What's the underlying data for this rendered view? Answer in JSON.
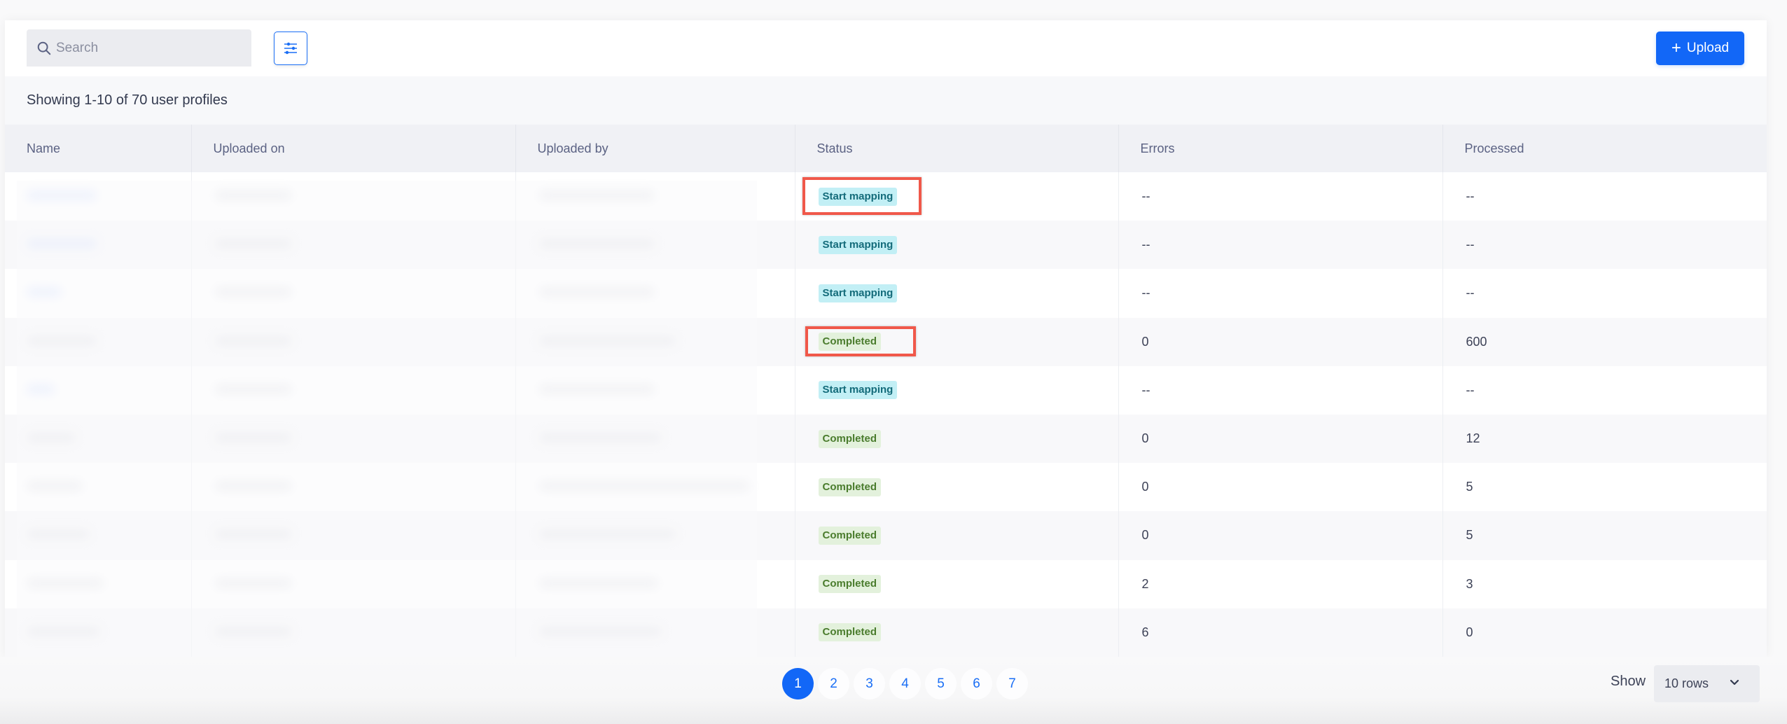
{
  "toolbar": {
    "search_placeholder": "Search",
    "search_value": "",
    "filter_icon": "sliders-icon",
    "upload_label": "Upload",
    "upload_icon": "plus-icon"
  },
  "summary": "Showing 1-10 of 70 user profiles",
  "table": {
    "columns": [
      "Name",
      "Uploaded on",
      "Uploaded by",
      "Status",
      "Errors",
      "Processed"
    ],
    "rows": [
      {
        "name": "",
        "uploaded_on": "",
        "uploaded_by": "",
        "status": "Start mapping",
        "status_type": "mapping",
        "errors": "--",
        "processed": "--",
        "highlighted": true
      },
      {
        "name": "",
        "uploaded_on": "",
        "uploaded_by": "",
        "status": "Start mapping",
        "status_type": "mapping",
        "errors": "--",
        "processed": "--",
        "highlighted": false
      },
      {
        "name": "",
        "uploaded_on": "",
        "uploaded_by": "",
        "status": "Start mapping",
        "status_type": "mapping",
        "errors": "--",
        "processed": "--",
        "highlighted": false
      },
      {
        "name": "",
        "uploaded_on": "",
        "uploaded_by": "",
        "status": "Completed",
        "status_type": "completed",
        "errors": "0",
        "processed": "600",
        "highlighted": true
      },
      {
        "name": "",
        "uploaded_on": "",
        "uploaded_by": "",
        "status": "Start mapping",
        "status_type": "mapping",
        "errors": "--",
        "processed": "--",
        "highlighted": false
      },
      {
        "name": "",
        "uploaded_on": "",
        "uploaded_by": "",
        "status": "Completed",
        "status_type": "completed",
        "errors": "0",
        "processed": "12",
        "highlighted": false
      },
      {
        "name": "",
        "uploaded_on": "",
        "uploaded_by": "",
        "status": "Completed",
        "status_type": "completed",
        "errors": "0",
        "processed": "5",
        "highlighted": false
      },
      {
        "name": "",
        "uploaded_on": "",
        "uploaded_by": "",
        "status": "Completed",
        "status_type": "completed",
        "errors": "0",
        "processed": "5",
        "highlighted": false
      },
      {
        "name": "",
        "uploaded_on": "",
        "uploaded_by": "",
        "status": "Completed",
        "status_type": "completed",
        "errors": "2",
        "processed": "3",
        "highlighted": false
      },
      {
        "name": "",
        "uploaded_on": "",
        "uploaded_by": "",
        "status": "Completed",
        "status_type": "completed",
        "errors": "6",
        "processed": "0",
        "highlighted": false
      }
    ],
    "redacted_columns": [
      "Name",
      "Uploaded on",
      "Uploaded by"
    ]
  },
  "pagination": {
    "pages": [
      "1",
      "2",
      "3",
      "4",
      "5",
      "6",
      "7"
    ],
    "current": "1"
  },
  "rows_per_page": {
    "label": "Show",
    "selected": "10 rows"
  },
  "colors": {
    "primary": "#1267f7",
    "mapping_badge_bg": "#c2eff5",
    "mapping_badge_text": "#136b7a",
    "completed_badge_bg": "#e3f1dc",
    "completed_badge_text": "#4a7c2d",
    "highlight": "#f0584a"
  }
}
